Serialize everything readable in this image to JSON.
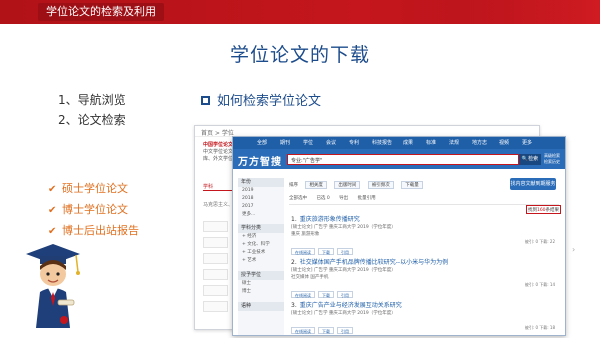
{
  "topbar": {
    "tab_label": "学位论文的检索及利用"
  },
  "slide": {
    "title": "学位论文的下载",
    "left_items": [
      "1、导航浏览",
      "2、论文检索"
    ],
    "section_heading": "如何检索学位论文",
    "bullets": [
      "硕士学位论文",
      "博士学位论文",
      "博士后出站报告"
    ]
  },
  "background_page": {
    "breadcrumb": "首页 > 学位",
    "info_lines": [
      "中国学位论文",
      "中文学位论文",
      "库、外文学位论文"
    ],
    "tab_label": "学科",
    "form_label": "马克思主义、"
  },
  "wanfang": {
    "nav_items": [
      "全部",
      "期刊",
      "学位",
      "会议",
      "专利",
      "科技报告",
      "成果",
      "标准",
      "法规",
      "地方志",
      "视频",
      "更多"
    ],
    "logo": "万方智搜",
    "search_query": "专业:\"广告学\"",
    "search_button": "检索",
    "help_links": [
      "高级检索",
      "检索历史"
    ],
    "toolbar": [
      "排序",
      "相关度",
      "出版时间",
      "被引频次",
      "下载量"
    ],
    "blue_button": "找内容文献到期服务",
    "select_row": [
      "全部选中",
      "已选 0",
      "导出",
      "批量引用"
    ],
    "result_count_prefix": "找到",
    "result_count_value": "160",
    "result_count_suffix": "条结果",
    "sidebar": {
      "year_head": "年份",
      "years": [
        "2019",
        "2018",
        "2017",
        "更多..."
      ],
      "subject_head": "学科分类",
      "subjects": [
        "+ 经济",
        "+ 文化、科学",
        "+ 工业技术",
        "+ 艺术"
      ],
      "degree_head": "授予学位",
      "degrees": [
        "硕士",
        "博士"
      ],
      "language_head": "语种"
    },
    "results": [
      {
        "num": "1.",
        "title": "重庆旅游形象传播研究",
        "meta": "[硕士论文] 广告学 重庆工商大学 2019（学位年度）",
        "extra": "重庆 旅游形象",
        "stat": "被引: 0   下载: 22"
      },
      {
        "num": "2.",
        "title": "社交媒体国产手机品牌传播比较研究--以小米与华为为例",
        "meta": "[硕士论文] 广告学 重庆工商大学 2019（学位年度）",
        "extra": "社交媒体 国产手机",
        "stat": "被引: 0   下载: 14"
      },
      {
        "num": "3.",
        "title": "重庆广告产业与经济发展互动关系研究",
        "meta": "[硕士论文] 广告学 重庆工商大学 2019（学位年度）",
        "extra": "",
        "stat": "被引: 0   下载: 18"
      }
    ],
    "result_buttons": [
      "在线阅读",
      "下载",
      "引用"
    ]
  }
}
